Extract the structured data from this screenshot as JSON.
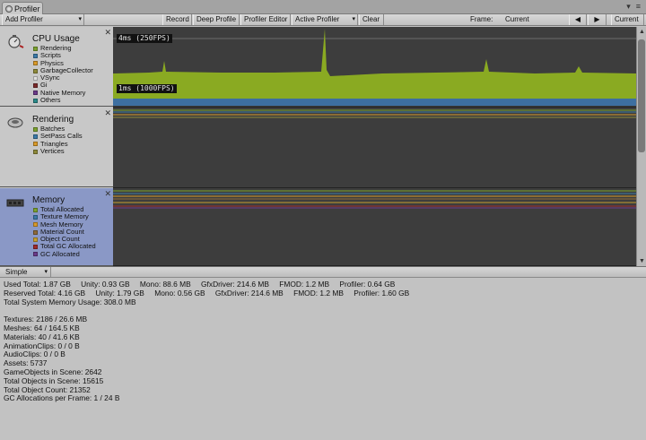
{
  "window": {
    "tab_title": "Profiler",
    "controls": [
      "≡",
      "▾"
    ]
  },
  "toolbar": {
    "add_profiler": "Add Profiler",
    "record": "Record",
    "deep_profile": "Deep Profile",
    "profiler_editor": "Profiler Editor",
    "active_profiler": "Active Profiler",
    "clear": "Clear",
    "frame_label": "Frame:",
    "frame_value": "Current",
    "prev_icon": "◀",
    "next_icon": "▶",
    "current_button": "Current"
  },
  "modules": [
    {
      "title": "CPU Usage",
      "selected": false,
      "legend": [
        {
          "label": "Rendering",
          "color": "#7ca22f"
        },
        {
          "label": "Scripts",
          "color": "#3b7aa8"
        },
        {
          "label": "Physics",
          "color": "#d99a2a"
        },
        {
          "label": "GarbageCollector",
          "color": "#8e8a3a"
        },
        {
          "label": "VSync",
          "color": "#e0e0e0"
        },
        {
          "label": "Gi",
          "color": "#7a2a2a"
        },
        {
          "label": "Native Memory",
          "color": "#6a3a8a"
        },
        {
          "label": "Others",
          "color": "#2a8a8a"
        }
      ]
    },
    {
      "title": "Rendering",
      "selected": false,
      "legend": [
        {
          "label": "Batches",
          "color": "#7ca22f"
        },
        {
          "label": "SetPass Calls",
          "color": "#3b7aa8"
        },
        {
          "label": "Triangles",
          "color": "#d99a2a"
        },
        {
          "label": "Vertices",
          "color": "#8e8a3a"
        }
      ]
    },
    {
      "title": "Memory",
      "selected": true,
      "legend": [
        {
          "label": "Total Allocated",
          "color": "#7ca22f"
        },
        {
          "label": "Texture Memory",
          "color": "#3b7aa8"
        },
        {
          "label": "Mesh Memory",
          "color": "#d99a2a"
        },
        {
          "label": "Material Count",
          "color": "#8e6a3a"
        },
        {
          "label": "Object Count",
          "color": "#c8a030"
        },
        {
          "label": "Total GC Allocated",
          "color": "#a02a2a"
        },
        {
          "label": "GC Allocated",
          "color": "#6a3a8a"
        }
      ]
    }
  ],
  "cpu_graph": {
    "tag_top": "4ms (250FPS)",
    "tag_bottom": "1ms (1000FPS)",
    "rendering_color": "#8aaa22",
    "scripts_color": "#3d6fa0"
  },
  "view_mode": "Simple",
  "memory_details": {
    "used_total": [
      "Used Total: 1.87 GB",
      "Unity: 0.93 GB",
      "Mono: 88.6 MB",
      "GfxDriver: 214.6 MB",
      "FMOD: 1.2 MB",
      "Profiler: 0.64 GB"
    ],
    "reserved_total": [
      "Reserved Total: 4.16 GB",
      "Unity: 1.79 GB",
      "Mono: 0.56 GB",
      "GfxDriver: 214.6 MB",
      "FMOD: 1.2 MB",
      "Profiler: 1.60 GB"
    ],
    "system_usage": "Total System Memory Usage: 308.0 MB",
    "assets": [
      "Textures: 2186 / 26.6 MB",
      "Meshes: 64 / 164.5 KB",
      "Materials: 40 / 41.6 KB",
      "AnimationClips: 0 / 0 B",
      "AudioClips: 0 / 0 B",
      "Assets: 5737",
      "GameObjects in Scene: 2642",
      "Total Objects in Scene: 15615",
      "Total Object Count: 21352",
      "GC Allocations per Frame: 1 / 24 B"
    ]
  }
}
